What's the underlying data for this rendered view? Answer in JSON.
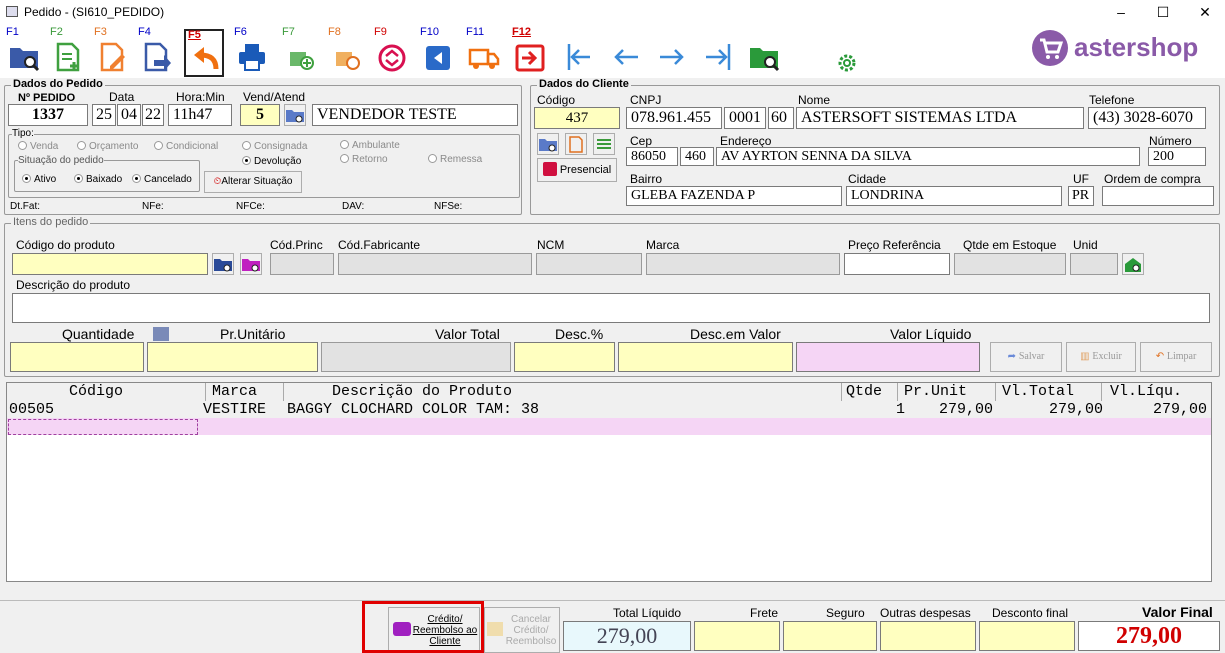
{
  "window": {
    "title": "Pedido - (SI610_PEDIDO)",
    "minimize": "–",
    "maximize": "☐",
    "close": "✕"
  },
  "toolbar": {
    "keys": [
      "F1",
      "F2",
      "F3",
      "F4",
      "F5",
      "F6",
      "F7",
      "F8",
      "F9",
      "F10",
      "F11",
      "F12"
    ]
  },
  "brand": {
    "name": "astershop",
    "color": "#8a5aa8"
  },
  "pedido": {
    "section": "Dados do Pedido",
    "num_label": "Nº PEDIDO",
    "num": "1337",
    "data_label": "Data",
    "day": "25",
    "month": "04",
    "year": "22",
    "hora_label": "Hora:Min",
    "hora": "11h47",
    "vend_label": "Vend/Atend",
    "vend": "5",
    "vendedor": "VENDEDOR TESTE",
    "tipo_label": "Tipo:",
    "tipos": [
      "Venda",
      "Orçamento",
      "Condicional",
      "Consignada",
      "Devolução",
      "Ambulante",
      "Retorno",
      "Remessa"
    ],
    "situacao_label": "Situação do pedido",
    "situacoes": [
      "Ativo",
      "Baixado",
      "Cancelado"
    ],
    "alterar": "Alterar Situação",
    "dtfat": "Dt.Fat:",
    "nfe": "NFe:",
    "nfce": "NFCe:",
    "dav": "DAV:",
    "nfse": "NFSe:"
  },
  "cliente": {
    "section": "Dados do Cliente",
    "codigo_label": "Código",
    "codigo": "437",
    "cnpj_label": "CNPJ",
    "cnpj1": "078.961.455",
    "cnpj2": "0001",
    "cnpj3": "60",
    "nome_label": "Nome",
    "nome": "ASTERSOFT SISTEMAS LTDA",
    "tel_label": "Telefone",
    "tel": "(43) 3028-6070",
    "cep_label": "Cep",
    "cep1": "86050",
    "cep2": "460",
    "end_label": "Endereço",
    "end": "AV AYRTON SENNA DA SILVA",
    "num_label": "Número",
    "num": "200",
    "presencial": "Presencial",
    "bairro_label": "Bairro",
    "bairro": "GLEBA FAZENDA P",
    "cidade_label": "Cidade",
    "cidade": "LONDRINA",
    "uf_label": "UF",
    "uf": "PR",
    "oc_label": "Ordem de compra",
    "oc": ""
  },
  "itens": {
    "section": "Itens do pedido",
    "cod_label": "Código do produto",
    "codprinc_label": "Cód.Princ",
    "codfab_label": "Cód.Fabricante",
    "ncm_label": "NCM",
    "marca_label": "Marca",
    "preco_label": "Preço Referência",
    "estoque_label": "Qtde em Estoque",
    "unid_label": "Unid",
    "desc_label": "Descrição do produto",
    "qtd_label": "Quantidade",
    "pru_label": "Pr.Unitário",
    "vt_label": "Valor Total",
    "descp_label": "Desc.%",
    "descv_label": "Desc.em Valor",
    "vl_label": "Valor Líquido",
    "salvar": "Salvar",
    "excluir": "Excluir",
    "limpar": "Limpar"
  },
  "grid": {
    "headers": [
      "Código",
      "Marca",
      "Descrição do Produto",
      "Qtde",
      "Pr.Unit",
      "Vl.Total",
      "Vl.Líqu."
    ],
    "rows": [
      {
        "codigo": "00505",
        "marca": "VESTIRE",
        "descricao": "BAGGY CLOCHARD COLOR TAM: 38",
        "qtde": "1",
        "prunit": "279,00",
        "vltotal": "279,00",
        "vlliq": "279,00"
      }
    ]
  },
  "footer": {
    "credito": "Crédito/ Reembolso ao Cliente",
    "cancelar": "Cancelar Crédito/ Reembolso",
    "total_liq_label": "Total Líquido",
    "total_liq": "279,00",
    "frete_label": "Frete",
    "seguro_label": "Seguro",
    "outras_label": "Outras despesas",
    "desconto_label": "Desconto final",
    "valor_final_label": "Valor Final",
    "valor_final": "279,00"
  }
}
